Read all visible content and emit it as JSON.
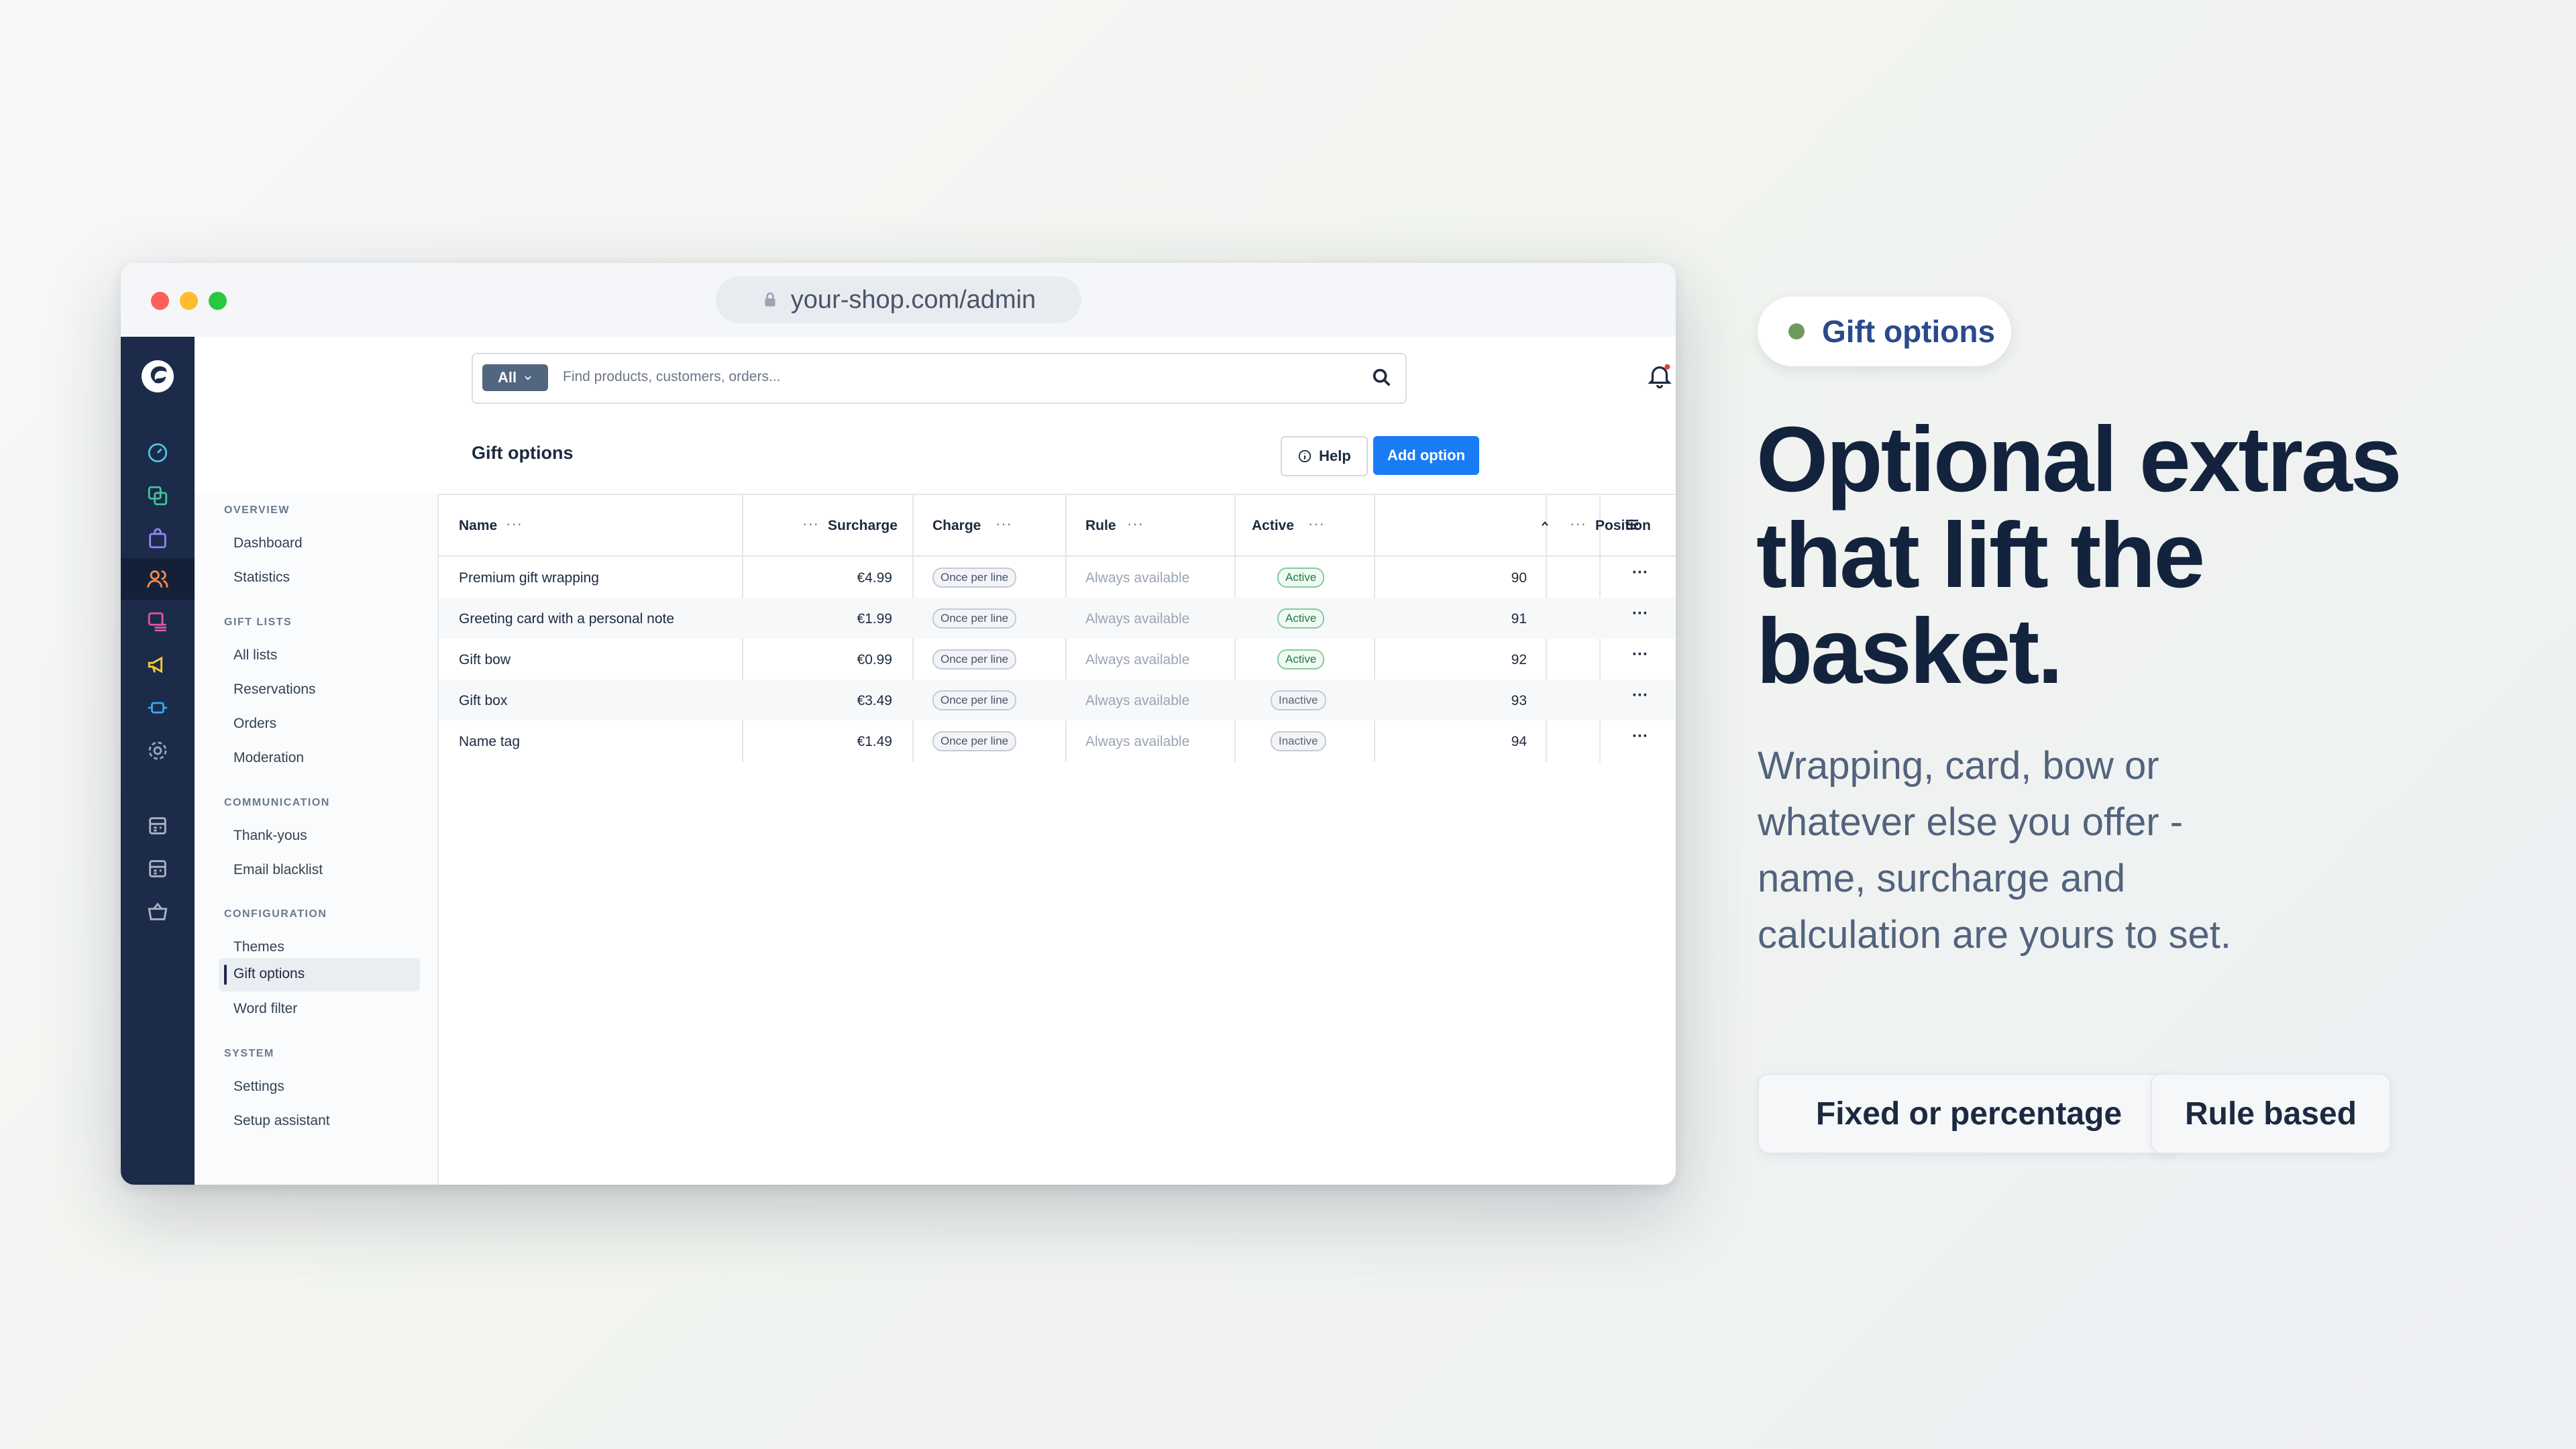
{
  "browser": {
    "url": "your-shop.com/admin"
  },
  "search": {
    "scope": "All",
    "placeholder": "Find products, customers, orders..."
  },
  "page": {
    "title": "Gift options",
    "help_label": "Help",
    "add_label": "Add option"
  },
  "subnav": {
    "sections": [
      {
        "title": "OVERVIEW",
        "items": [
          "Dashboard",
          "Statistics"
        ]
      },
      {
        "title": "GIFT LISTS",
        "items": [
          "All lists",
          "Reservations",
          "Orders",
          "Moderation"
        ]
      },
      {
        "title": "COMMUNICATION",
        "items": [
          "Thank-yous",
          "Email blacklist"
        ]
      },
      {
        "title": "CONFIGURATION",
        "items": [
          "Themes",
          "Gift options",
          "Word filter"
        ]
      },
      {
        "title": "SYSTEM",
        "items": [
          "Settings",
          "Setup assistant"
        ]
      }
    ],
    "active": "Gift options"
  },
  "table": {
    "headers": {
      "name": "Name",
      "surcharge": "Surcharge",
      "charge": "Charge",
      "rule": "Rule",
      "active": "Active",
      "position": "Position"
    },
    "rows": [
      {
        "name": "Premium gift wrapping",
        "surcharge": "€4.99",
        "charge": "Once per line",
        "rule": "Always available",
        "status": "Active",
        "position": "90"
      },
      {
        "name": "Greeting card with a personal note",
        "surcharge": "€1.99",
        "charge": "Once per line",
        "rule": "Always available",
        "status": "Active",
        "position": "91"
      },
      {
        "name": "Gift bow",
        "surcharge": "€0.99",
        "charge": "Once per line",
        "rule": "Always available",
        "status": "Active",
        "position": "92"
      },
      {
        "name": "Gift box",
        "surcharge": "€3.49",
        "charge": "Once per line",
        "rule": "Always available",
        "status": "Inactive",
        "position": "93"
      },
      {
        "name": "Name tag",
        "surcharge": "€1.49",
        "charge": "Once per line",
        "rule": "Always available",
        "status": "Inactive",
        "position": "94"
      }
    ]
  },
  "marketing": {
    "badge": "Gift options",
    "headline_lines": [
      "Optional extras",
      "that lift the",
      "basket."
    ],
    "lede": "Wrapping, card, bow or whatever else you offer - name, surcharge and calculation are yours to set.",
    "chips": [
      "Fixed or percentage",
      "Rule based"
    ]
  },
  "colors": {
    "primary": "#1a7cf5",
    "rail": "#1c2b4a",
    "headline": "#14233d",
    "badge_dot": "#6f9a5f"
  }
}
